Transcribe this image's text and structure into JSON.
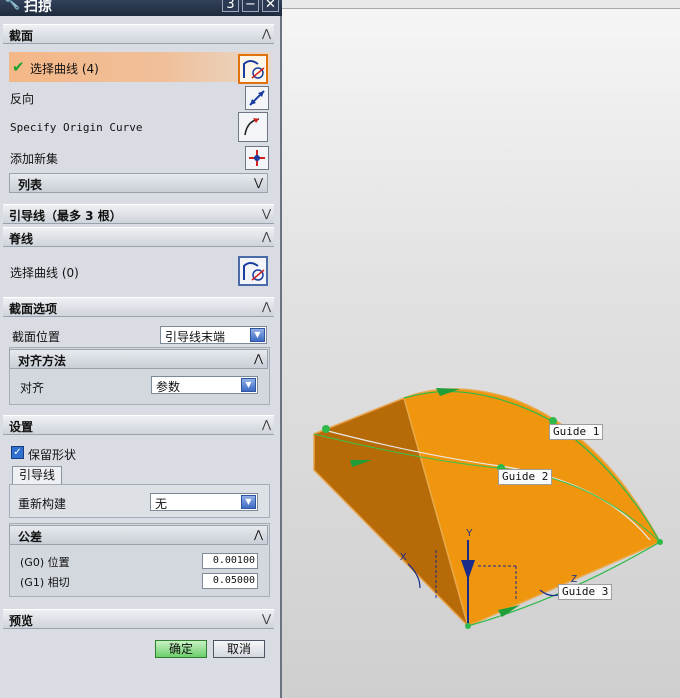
{
  "dialog": {
    "title": "扫掠",
    "title_buttons": [
      "3",
      "−",
      "✕"
    ],
    "section_section": {
      "label": "截面",
      "select_curve": "选择曲线 (4)",
      "reverse": "反向",
      "specify_origin": "Specify Origin Curve",
      "add_new_set": "添加新集",
      "list": "列表"
    },
    "guides": {
      "label": "引导线（最多 3 根）"
    },
    "spine": {
      "label": "脊线",
      "select_curve": "选择曲线 (0)"
    },
    "section_options": {
      "label": "截面选项",
      "position_label": "截面位置",
      "position_value": "引导线末端",
      "alignment": {
        "label": "对齐方法",
        "align_label": "对齐",
        "align_value": "参数"
      }
    },
    "settings": {
      "label": "设置",
      "preserve_shape": "保留形状",
      "preserve_shape_checked": true,
      "tab": "引导线",
      "rebuild_label": "重新构建",
      "rebuild_value": "无",
      "tolerance": {
        "label": "公差",
        "g0_label": "(G0) 位置",
        "g0_value": "0.00100",
        "g1_label": "(G1) 相切",
        "g1_value": "0.05000"
      }
    },
    "preview": {
      "label": "预览"
    },
    "ok": "确定",
    "cancel": "取消"
  },
  "viewport": {
    "guide_labels": [
      "Guide 1",
      "Guide 2",
      "Guide 3"
    ],
    "axis_labels": [
      "Y",
      "X",
      "Z"
    ],
    "surface_color": "#f0960e",
    "surface_dark": "#b86a08",
    "curve_color": "#27b33a"
  }
}
